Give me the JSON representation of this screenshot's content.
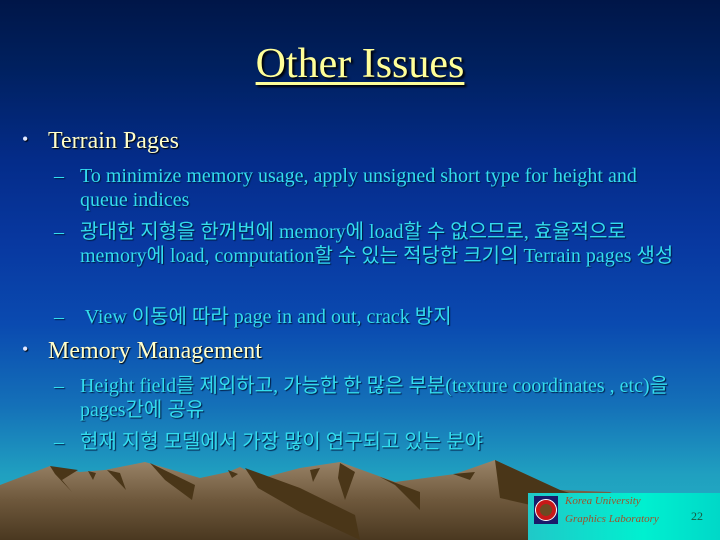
{
  "slide": {
    "title": "Other Issues",
    "page_number": "22",
    "colors": {
      "background_top": "#001648",
      "background_bottom": "#24b4c4",
      "title": "#ffff99",
      "bullet_text": "#ffffcc",
      "sub_text": "#33ddee"
    }
  },
  "sections": [
    {
      "heading": "Terrain Pages",
      "items": [
        "To minimize memory usage, apply unsigned short type for height and queue indices",
        "광대한 지형을 한꺼번에 memory에 load할 수 없으므로, 효율적으로 memory에 load, computation할 수 있는 적당한 크기의 Terrain pages 생성",
        " View 이동에 따라 page in and out, crack 방지"
      ]
    },
    {
      "heading": "Memory Management",
      "items": [
        "Height field를 제외하고, 가능한 한 많은 부분(texture coordinates , etc)을 pages간에 공유",
        "현재 지형 모델에서 가장 많이 연구되고 있는 분야"
      ]
    }
  ],
  "bullet_symbol": "•",
  "dash_symbol": "–",
  "footer": {
    "line1": "Korea University",
    "line2": "Graphics Laboratory",
    "logo_icon": "korea-university-tiger-emblem"
  }
}
